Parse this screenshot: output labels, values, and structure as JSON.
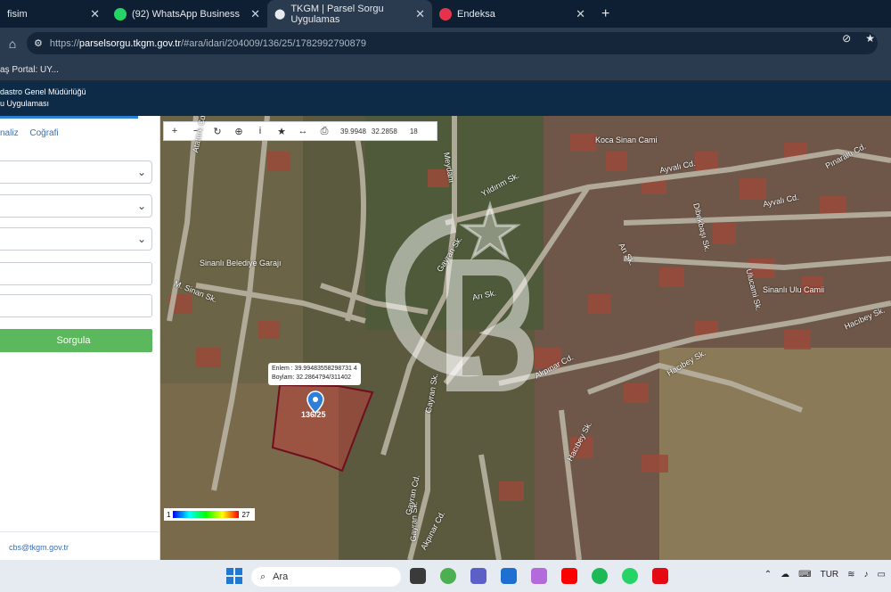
{
  "browser": {
    "tabs": [
      {
        "label": "fisim"
      },
      {
        "label": "(92) WhatsApp Business"
      },
      {
        "label": "TKGM | Parsel Sorgu Uygulamas"
      },
      {
        "label": "Endeksa"
      }
    ],
    "url_prefix": "https://",
    "url_site": "parselsorgu.tkgm.gov.tr",
    "url_path": "/#ara/idari/204009/136/25/1782992790879",
    "bookmark": "aş Portal: UY..."
  },
  "app": {
    "org_line1": "dastro Genel Müdürlüğü",
    "org_line2": "u Uygulaması"
  },
  "sidebar": {
    "tab1": "naliz",
    "tab2": "Coğrafi",
    "search_button": "Sorgula",
    "email": "cbs@tkgm.gov.tr"
  },
  "map": {
    "coord_lat": "39.9948",
    "coord_lon": "32.2858",
    "zoom": "18",
    "popup_line1": "Enlem : 39.99483558298731 4",
    "popup_line2": "Boylam: 32.2864794/311402",
    "parcel": "136/25",
    "legend_min": "1",
    "legend_max": "27",
    "labels": {
      "ataturk": "Atatürk Cd.",
      "meydani": "Meydanı",
      "koca_sinan": "Koca Sinan Cami",
      "ayvali1": "Ayvalı Cd.",
      "ayvali2": "Ayvalı Cd.",
      "pinaralti": "Pınaraltı Cd.",
      "yildirim": "Yıldırım Sk.",
      "gayran1": "Gayran Sk.",
      "gayran2": "Gayran Sk.",
      "gayran3": "Gayran Sk.",
      "gayran_cd": "Gayran Cd.",
      "sinanli_garaj": "Sinanlı Belediye Garajı",
      "sinan_sk": "M. Sinan Sk.",
      "ari1": "Arı Sk.",
      "ari2": "Arı Sk.",
      "dibekbasi": "Dibekbaşı Sk.",
      "sinanli_ulu": "Sinanlı Ulu Camii",
      "ulucami": "Ulucami Sk.",
      "hacibey1": "Hacıbey Sk.",
      "hacibey2": "Hacıbey Sk.",
      "hacibey3": "Hacıbey Sk.",
      "akpinar1": "Akpınar Cd.",
      "akpinar2": "Akpınar Cd."
    }
  },
  "taskbar": {
    "search_placeholder": "Ara",
    "lang": "TUR"
  }
}
